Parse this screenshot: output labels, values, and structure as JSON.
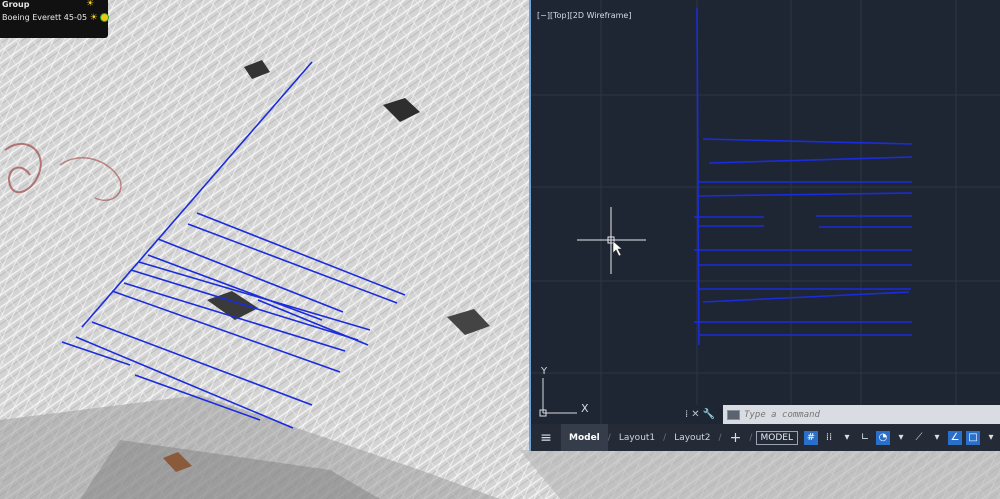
{
  "layer_panel": {
    "line1": "Group",
    "line2": "Boeing Everett 45-05",
    "icons": [
      "sun-icon",
      "sun-icon",
      "point-cloud-gauge-icon"
    ]
  },
  "viewport": {
    "label": "[−][Top][2D Wireframe]",
    "axis_x": "X",
    "axis_y": "Y",
    "colors": {
      "background": "#1e2533",
      "grid": "#2e3646",
      "geometry": "#1a2cdc",
      "border": "#6fa3d8"
    }
  },
  "command_line": {
    "placeholder": "Type a command",
    "icons": [
      "close-icon",
      "wrench-icon",
      "command-prompt-icon"
    ]
  },
  "status_bar": {
    "tabs": [
      "Model",
      "Layout1",
      "Layout2"
    ],
    "active_tab": "Model",
    "add_tab": "+",
    "model_button": "MODEL",
    "icons": [
      "grid-icon",
      "snap-icon",
      "ortho-icon",
      "polar-icon",
      "isodraft-icon",
      "annotation-icon",
      "workspace-icon"
    ]
  }
}
